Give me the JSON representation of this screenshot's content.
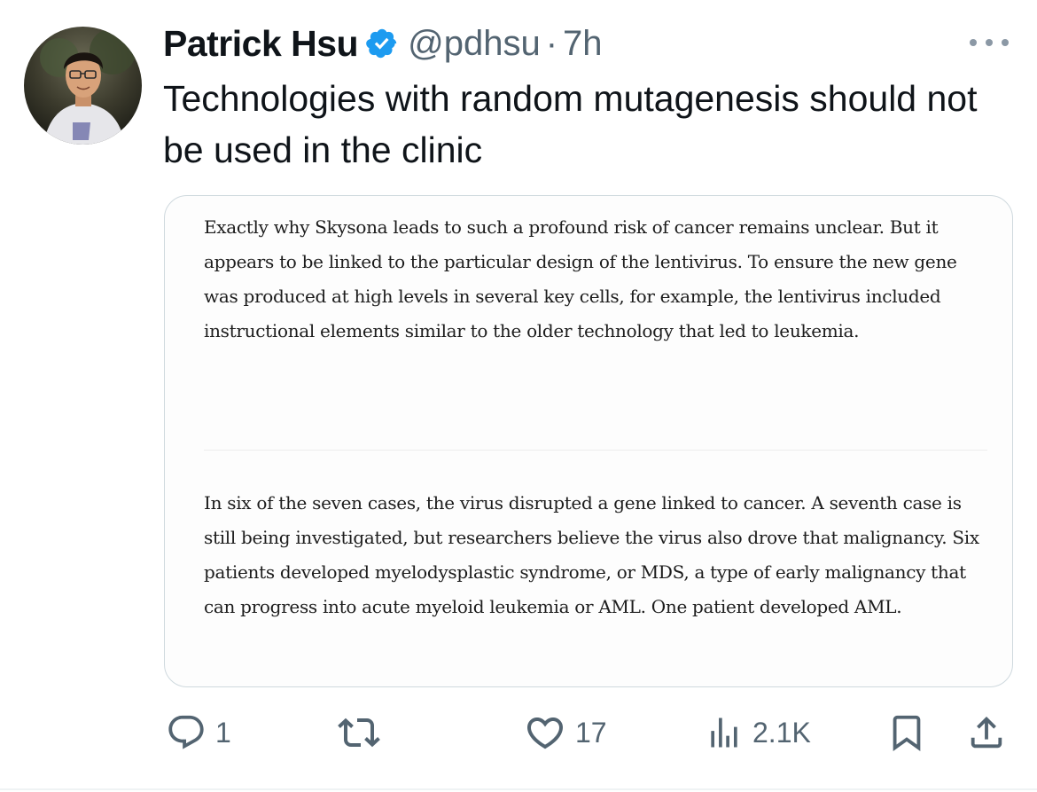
{
  "author": {
    "display_name": "Patrick Hsu",
    "handle": "@pdhsu",
    "separator": "·",
    "time": "7h"
  },
  "tweet": {
    "text": "Technologies with random mutagenesis should not be used in the clinic"
  },
  "media": {
    "paragraphs": [
      "Exactly why Skysona leads to such a profound risk of cancer remains unclear. But it appears to be linked to the particular design of the lentivirus. To ensure the new gene was produced at high levels in several key cells, for example, the lentivirus included instructional elements similar to the older technology that led to leukemia.",
      "In six of the seven cases, the virus disrupted a gene linked to cancer. A seventh case is still being investigated, but researchers believe the virus also drove that malignancy. Six patients developed myelodysplastic syndrome, or MDS, a type of early malignancy that can progress into acute myeloid leukemia or AML. One patient developed AML."
    ]
  },
  "actions": {
    "reply_count": "1",
    "retweet_count": "",
    "like_count": "17",
    "views_count": "2.1K"
  },
  "icons": {
    "verified": "verified-badge-icon",
    "more": "more-icon",
    "reply": "reply-icon",
    "retweet": "retweet-icon",
    "like": "heart-icon",
    "views": "views-icon",
    "bookmark": "bookmark-icon",
    "share": "share-icon"
  },
  "colors": {
    "verified_blue": "#1d9bf0",
    "text_primary": "#0f1419",
    "text_secondary": "#536471",
    "border": "#cfd9de"
  }
}
